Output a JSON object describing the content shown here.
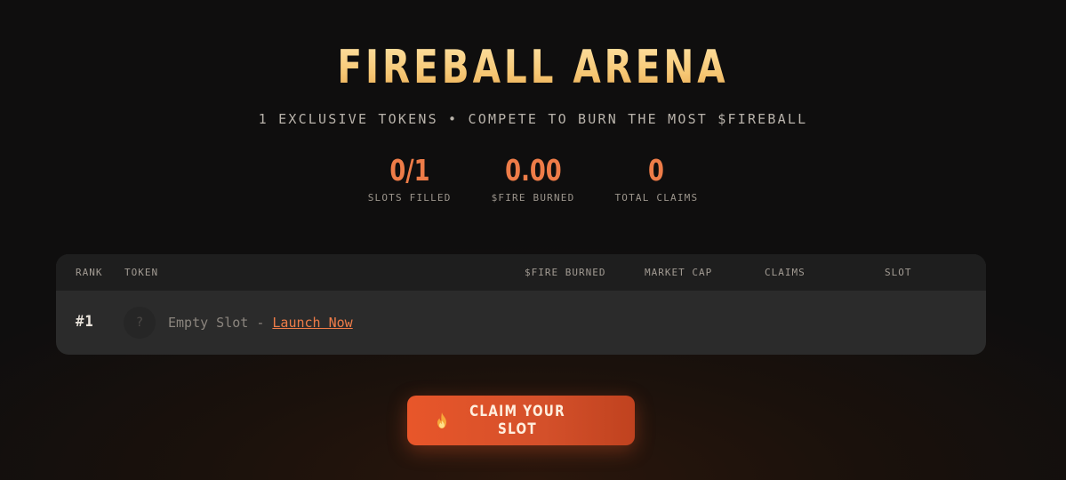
{
  "header": {
    "title": "FIREBALL ARENA",
    "subtitle": "1 EXCLUSIVE TOKENS • COMPETE TO BURN THE MOST $FIREBALL"
  },
  "stats": [
    {
      "value": "0/1",
      "label": "SLOTS FILLED"
    },
    {
      "value": "0.00",
      "label": "$FIRE BURNED"
    },
    {
      "value": "0",
      "label": "TOTAL CLAIMS"
    }
  ],
  "table": {
    "columns": [
      "RANK",
      "TOKEN",
      "$FIRE BURNED",
      "MARKET CAP",
      "CLAIMS",
      "SLOT"
    ],
    "rows": [
      {
        "rank": "#1",
        "avatar_glyph": "?",
        "empty_text": "Empty Slot - ",
        "launch_link": "Launch Now"
      }
    ]
  },
  "cta": {
    "icon": "flame-icon",
    "label": "CLAIM YOUR SLOT"
  },
  "colors": {
    "accent": "#ee7c48",
    "button": "#e0532a",
    "title_gold": "#f6c774"
  }
}
